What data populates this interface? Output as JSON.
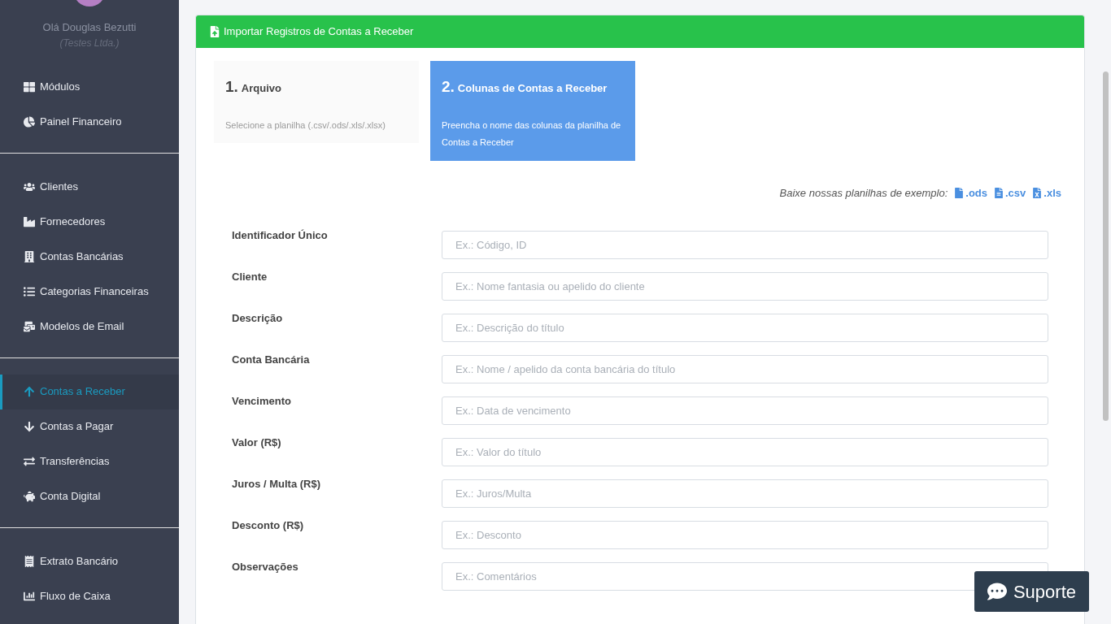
{
  "sidebar": {
    "user_name": "Olá Douglas Bezutti",
    "company": "(Testes Ltda.)",
    "groups": [
      {
        "items": [
          {
            "label": "Módulos",
            "selected": false
          },
          {
            "label": "Painel Financeiro",
            "selected": false
          }
        ]
      },
      {
        "items": [
          {
            "label": "Clientes",
            "selected": false
          },
          {
            "label": "Fornecedores",
            "selected": false
          },
          {
            "label": "Contas Bancárias",
            "selected": false
          },
          {
            "label": "Categorias Financeiras",
            "selected": false
          },
          {
            "label": "Modelos de Email",
            "selected": false
          }
        ]
      },
      {
        "items": [
          {
            "label": "Contas a Receber",
            "selected": true
          },
          {
            "label": "Contas a Pagar",
            "selected": false
          },
          {
            "label": "Transferências",
            "selected": false
          },
          {
            "label": "Conta Digital",
            "selected": false
          }
        ]
      },
      {
        "items": [
          {
            "label": "Extrato Bancário",
            "selected": false
          },
          {
            "label": "Fluxo de Caixa",
            "selected": false
          }
        ]
      }
    ]
  },
  "panel": {
    "title": "Importar Registros de Contas a Receber",
    "steps": [
      {
        "number": "1.",
        "title": "Arquivo",
        "description": "Selecione a planilha (.csv/.ods/.xls/.xlsx)",
        "selected": false
      },
      {
        "number": "2.",
        "title": "Colunas de Contas a Receber",
        "description": "Preencha o nome das colunas da planilha de Contas a Receber",
        "selected": true
      }
    ],
    "examples_label": "Baixe nossas planilhas de exemplo:",
    "example_links": [
      ".ods",
      ".csv",
      ".xls"
    ],
    "fields": [
      {
        "label": "Identificador Único",
        "placeholder": "Ex.: Código, ID"
      },
      {
        "label": "Cliente",
        "placeholder": "Ex.: Nome fantasia ou apelido do cliente"
      },
      {
        "label": "Descrição",
        "placeholder": "Ex.: Descrição do título"
      },
      {
        "label": "Conta Bancária",
        "placeholder": "Ex.: Nome / apelido da conta bancária do título"
      },
      {
        "label": "Vencimento",
        "placeholder": "Ex.: Data de vencimento"
      },
      {
        "label": "Valor (R$)",
        "placeholder": "Ex.: Valor do título"
      },
      {
        "label": "Juros / Multa (R$)",
        "placeholder": "Ex.: Juros/Multa"
      },
      {
        "label": "Desconto (R$)",
        "placeholder": "Ex.: Desconto"
      },
      {
        "label": "Observações",
        "placeholder": "Ex.: Comentários"
      }
    ]
  },
  "support_button": "Suporte"
}
